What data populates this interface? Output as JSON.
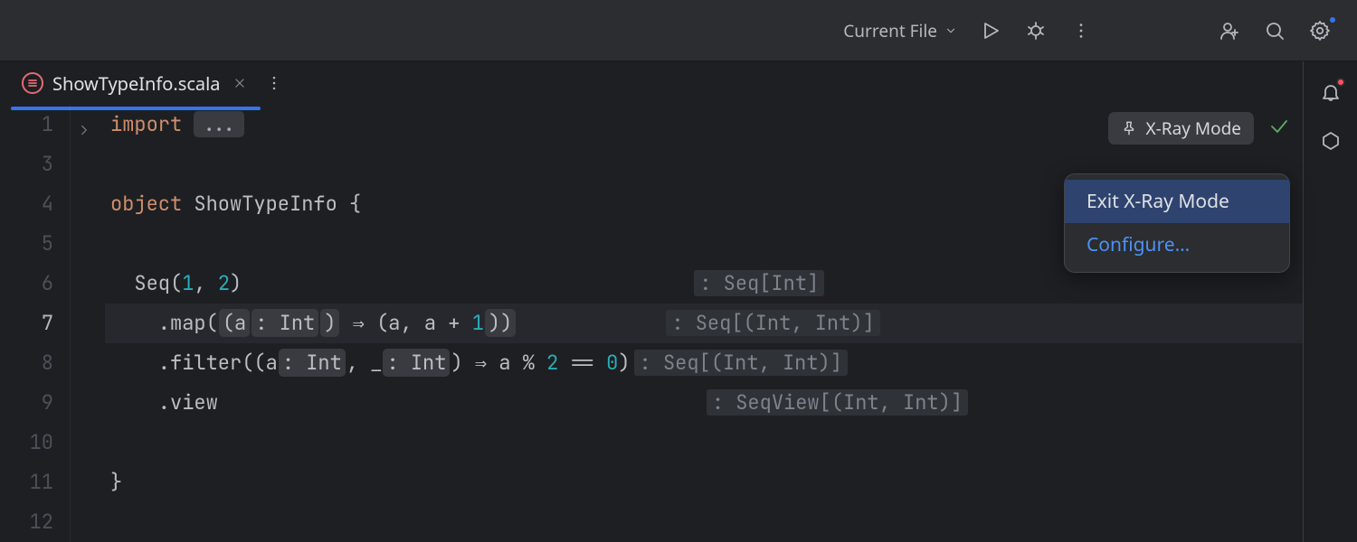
{
  "toolbar": {
    "run_config_label": "Current File"
  },
  "tab": {
    "filename": "ShowTypeInfo.scala"
  },
  "gutter": {
    "lines": [
      "1",
      "3",
      "4",
      "5",
      "6",
      "7",
      "8",
      "9",
      "10",
      "11",
      "12"
    ],
    "active_line": "7"
  },
  "code": {
    "l1": {
      "kw": "import",
      "folded": "..."
    },
    "l4": {
      "kw": "object",
      "ident": "ShowTypeInfo",
      "brace": " {"
    },
    "l6": {
      "seq": "Seq",
      "open": "(",
      "n1": "1",
      "comma": ", ",
      "n2": "2",
      "close": ")",
      "hint": ": Seq[Int]"
    },
    "l7": {
      "pre": "    .map(",
      "a": "(a",
      "t": ": Int",
      "close1": ")",
      "arrow": " ⇒ ",
      "body": "(a, a + ",
      "one": "1",
      "close2": "))",
      "hint": ": Seq[(Int, Int)]"
    },
    "l8": {
      "pre": "    .filter(",
      "a": "(a",
      "ta": ": Int",
      "comma": ", _",
      "tb": ": Int",
      "close1": ")",
      "arrow": " ⇒ ",
      "mid": "a % ",
      "two": "2",
      "eq": " == ",
      "zero": "0",
      "close2": ")",
      "hint": ": Seq[(Int, Int)]"
    },
    "l9": {
      "view": "    .view",
      "hint": ": SeqView[(Int, Int)]"
    },
    "l11": {
      "brace": "}"
    }
  },
  "overlay": {
    "xray_label": "X-Ray Mode"
  },
  "popup": {
    "exit": "Exit X-Ray Mode",
    "configure": "Configure…"
  },
  "settings_dot": true
}
